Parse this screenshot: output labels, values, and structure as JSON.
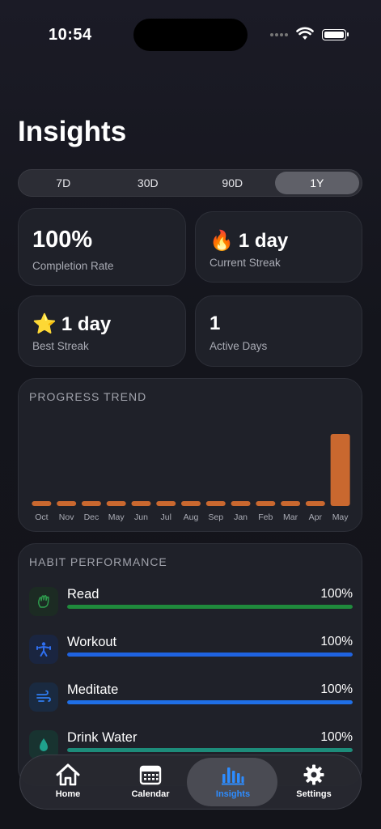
{
  "status_bar": {
    "time": "10:54"
  },
  "page_title": "Insights",
  "range_tabs": [
    "7D",
    "30D",
    "90D",
    "1Y"
  ],
  "selected_range": "1Y",
  "stats": {
    "completion": {
      "value": "100%",
      "label": "Completion Rate"
    },
    "current_streak": {
      "emoji": "🔥",
      "value": "1 day",
      "label": "Current Streak"
    },
    "best_streak": {
      "emoji": "⭐",
      "value": "1 day",
      "label": "Best Streak"
    },
    "active_days": {
      "value": "1",
      "label": "Active Days"
    }
  },
  "progress_trend": {
    "title": "PROGRESS TREND",
    "bar_color": "#c9682f"
  },
  "chart_data": {
    "type": "bar",
    "title": "PROGRESS TREND",
    "categories": [
      "Oct",
      "Nov",
      "Dec",
      "May",
      "Jun",
      "Jul",
      "Aug",
      "Sep",
      "Jan",
      "Feb",
      "Mar",
      "Apr",
      "May"
    ],
    "values": [
      0,
      0,
      0,
      0,
      0,
      0,
      0,
      0,
      0,
      0,
      0,
      0,
      100
    ],
    "ylim": [
      0,
      100
    ],
    "grid": false
  },
  "habit_performance": {
    "title": "HABIT PERFORMANCE",
    "habits": [
      {
        "name": "Read",
        "percent": "100%",
        "progress": 1.0,
        "color": "#1f8a3c",
        "icon": "hand-icon",
        "icon_bg": "#1c2b23",
        "icon_color": "#2fa24f"
      },
      {
        "name": "Workout",
        "percent": "100%",
        "progress": 1.0,
        "color": "#1f63e0",
        "icon": "figure-icon",
        "icon_bg": "#1a2540",
        "icon_color": "#2f6ff0"
      },
      {
        "name": "Meditate",
        "percent": "100%",
        "progress": 1.0,
        "color": "#1f6fe6",
        "icon": "wind-icon",
        "icon_bg": "#1a2a40",
        "icon_color": "#2f7cf0"
      },
      {
        "name": "Drink Water",
        "percent": "100%",
        "progress": 1.0,
        "color": "#1d8c7a",
        "icon": "drop-icon",
        "icon_bg": "#183330",
        "icon_color": "#1fa08c"
      }
    ]
  },
  "tab_bar": {
    "items": [
      {
        "label": "Home",
        "icon": "house-icon"
      },
      {
        "label": "Calendar",
        "icon": "calendar-icon"
      },
      {
        "label": "Insights",
        "icon": "chart-icon"
      },
      {
        "label": "Settings",
        "icon": "gear-icon"
      }
    ],
    "active": "Insights",
    "active_color": "#2d8cff"
  }
}
